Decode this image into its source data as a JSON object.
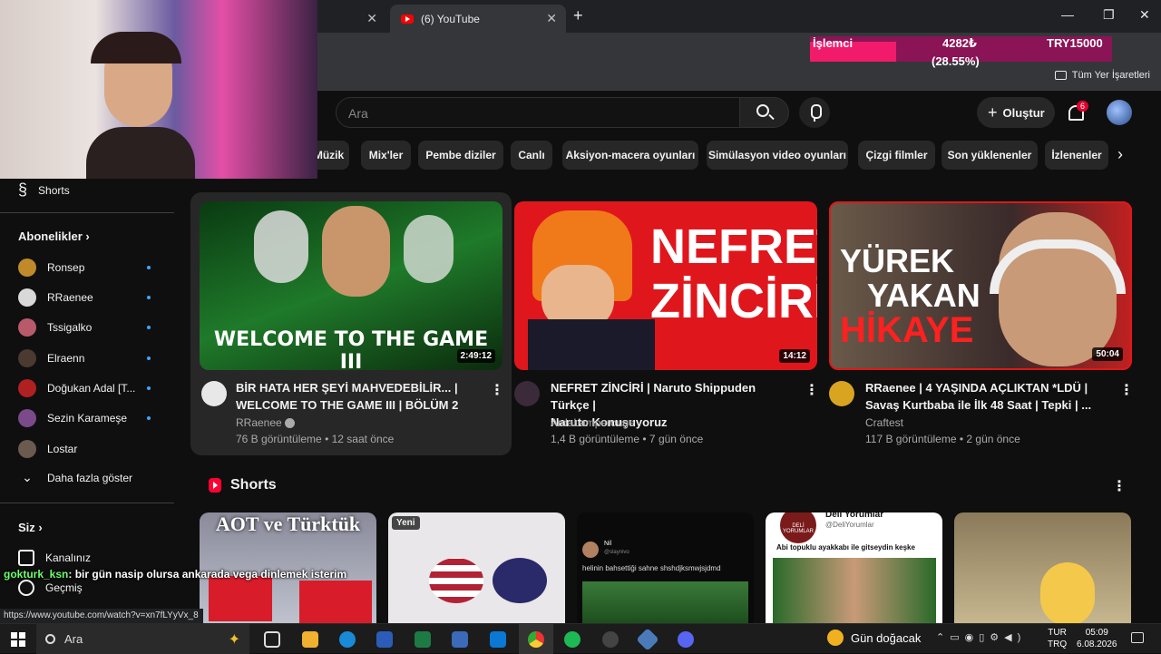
{
  "browser": {
    "active_tab": "(6) YouTube",
    "bookmarks_all": "Tüm Yer İşaretleri"
  },
  "ticker": {
    "label": "İşlemci",
    "value": "4282₺",
    "pct": "(28.55%)",
    "target": "TRY15000"
  },
  "header": {
    "search_placeholder": "Ara",
    "create_label": "Oluştur",
    "notif_count": "6"
  },
  "chips": [
    "Müzik",
    "Mix'ler",
    "Pembe diziler",
    "Canlı",
    "Aksiyon-macera oyunları",
    "Simülasyon video oyunları",
    "Çizgi filmler",
    "Son yüklenenler",
    "İzlenenler"
  ],
  "sidebar": {
    "shorts": "Shorts",
    "subs_title": "Abonelikler",
    "subs": [
      {
        "name": "Ronsep",
        "color": "#c08a2a"
      },
      {
        "name": "RRaenee",
        "color": "#d8d8d8"
      },
      {
        "name": "Tssigalko",
        "color": "#b85a6a"
      },
      {
        "name": "Elraenn",
        "color": "#4a3a30"
      },
      {
        "name": "Doğukan Adal [T...",
        "color": "#b02020"
      },
      {
        "name": "Sezin Karameşe",
        "color": "#7a4a8a"
      },
      {
        "name": "Lostar",
        "color": "#6a5a50"
      }
    ],
    "show_more": "Daha fazla göster",
    "you_title": "Siz",
    "channel": "Kanalınız",
    "history": "Geçmiş"
  },
  "videos": [
    {
      "title1": "BİR HATA HER ŞEYİ MAHVEDEBİLİR... |",
      "title2": "WELCOME TO THE GAME III | BÖLÜM 2",
      "channel": "RRaenee",
      "meta": "76 B görüntüleme • 12 saat önce",
      "duration": "2:49:12",
      "thumb_text": "WELCOME TO THE GAME III"
    },
    {
      "title1": "NEFRET ZİNCİRİ | Naruto Shippuden Türkçe |",
      "title2": "Naruto Konuşuyoruz",
      "channel": "ArdaLamperouge",
      "meta": "1,4 B görüntüleme • 7 gün önce",
      "duration": "14:12",
      "thumb_text1": "NEFRET",
      "thumb_text2": "ZİNCİRİ"
    },
    {
      "title1": "RRaenee | 4 YAŞINDA AÇLIKTAN *LDÜ |",
      "title2": "Savaş Kurtbaba ile İlk 48 Saat | Tepki | ...",
      "channel": "Craftest",
      "meta": "117 B görüntüleme • 2 gün önce",
      "duration": "50:04",
      "thumb_text1": "YÜREK",
      "thumb_text2": "YAKAN",
      "thumb_text3": "HİKAYE"
    }
  ],
  "shorts": {
    "title": "Shorts",
    "s1_text": "AOT ve Türktük",
    "s2_badge": "Yeni",
    "s3_user": "Nil",
    "s3_handle": "@slaynivo",
    "s3_text": "helinin bahsettiği sahne shshdjksmwjsjdmd",
    "s4_user": "Deli Yorumlar",
    "s4_handle": "@DeliYorumlar",
    "s4_text": "Abi topuklu ayakkabı ile gitseydin keşke",
    "s4_logo": "DELİ YORUMLAR"
  },
  "overlay": {
    "chat_user": "gokturk_ksn",
    "chat_msg": ": bir gün nasip olursa ankarada vega dinlemek isterim",
    "status_url": "https://www.youtube.com/watch?v=xn7fLYyVx_8"
  },
  "taskbar": {
    "search": "Ara",
    "weather": "Gün doğacak",
    "lang1": "TUR",
    "lang2": "TRQ",
    "time": "05:09",
    "date": "6.08.2026"
  }
}
